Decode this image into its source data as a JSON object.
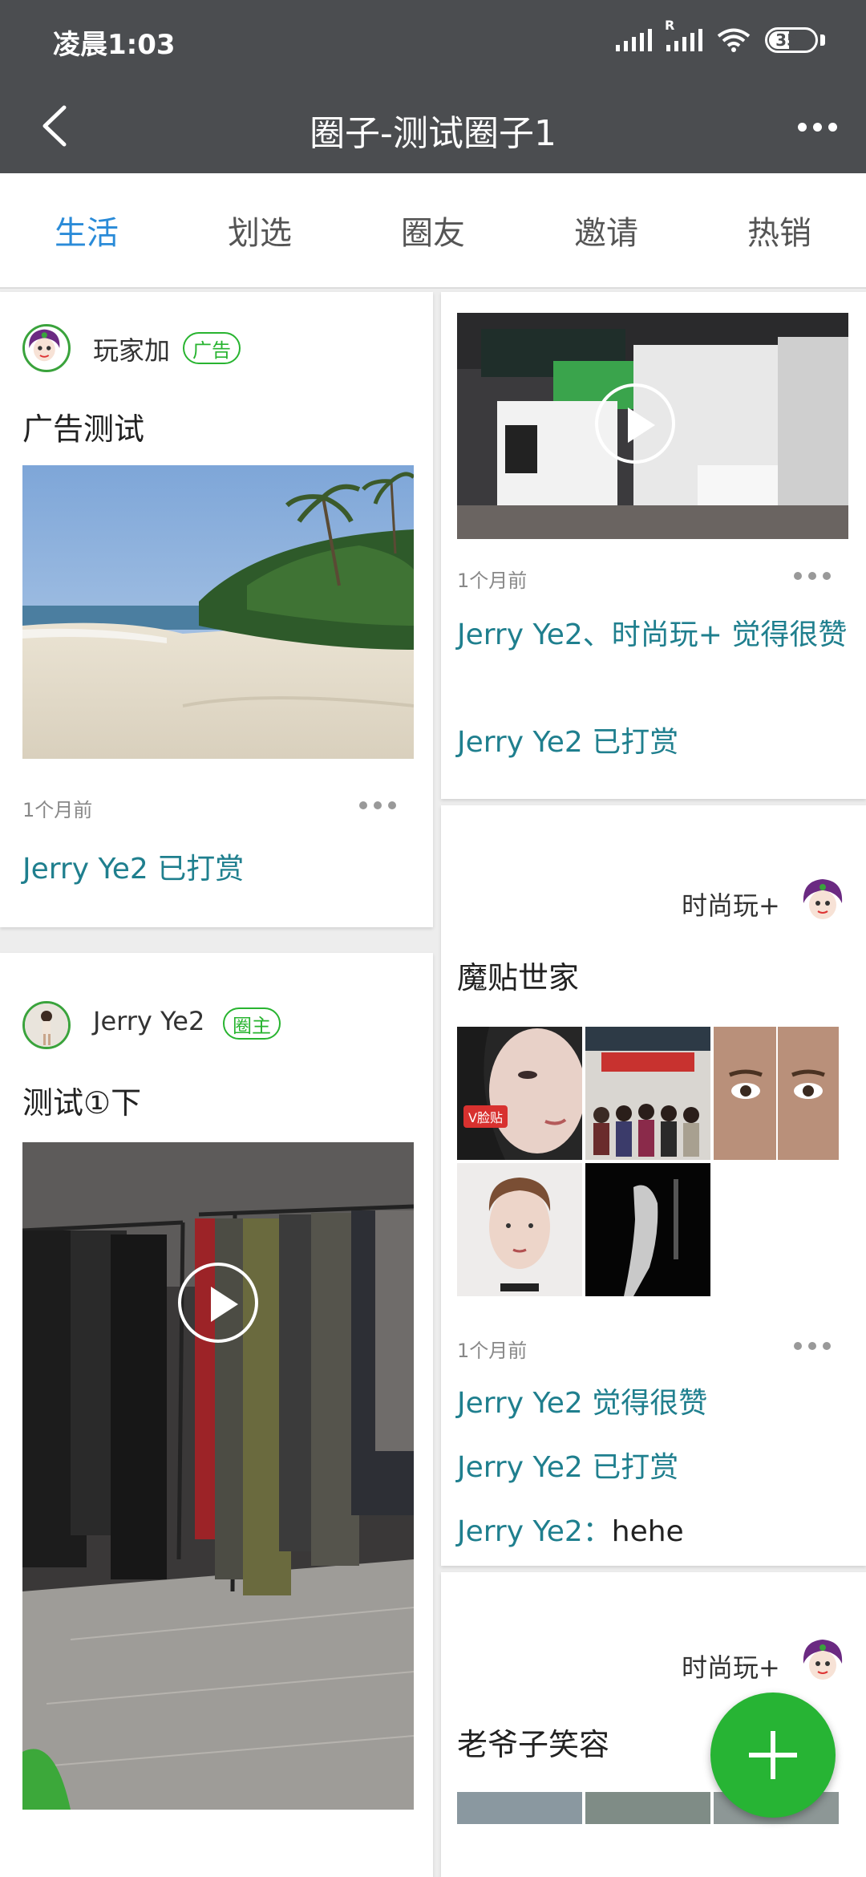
{
  "status_bar": {
    "time": "凌晨1:03",
    "battery": "35"
  },
  "header": {
    "title": "圈子-测试圈子1"
  },
  "tabs": [
    {
      "label": "生活",
      "active": true
    },
    {
      "label": "划选",
      "active": false
    },
    {
      "label": "圈友",
      "active": false
    },
    {
      "label": "邀请",
      "active": false
    },
    {
      "label": "热销",
      "active": false
    }
  ],
  "posts": {
    "ad_post": {
      "author": "玩家加",
      "badge": "广告",
      "title": "广告测试",
      "time": "1个月前",
      "interactions": [
        "Jerry Ye2 已打赏"
      ]
    },
    "video_post_right": {
      "time": "1个月前",
      "interactions": [
        "Jerry Ye2、时尚玩+ 觉得很赞",
        "Jerry Ye2 已打赏"
      ]
    },
    "mote_post": {
      "author": "时尚玩+",
      "title": "魔贴世家",
      "image_label": "V脸贴",
      "time": "1个月前",
      "interactions": [
        "Jerry Ye2 觉得很赞",
        "Jerry Ye2 已打赏"
      ],
      "comment": {
        "user": "Jerry Ye2：",
        "text": "hehe"
      }
    },
    "owner_post": {
      "author": "Jerry Ye2",
      "badge": "圈主",
      "title": "测试①下"
    },
    "laoyezi_post": {
      "author": "时尚玩+",
      "title": "老爷子笑容"
    }
  },
  "colors": {
    "accent_tab": "#2a8bd8",
    "fab": "#27b434",
    "link": "#1f7f8e",
    "badge": "#28b430",
    "header_bg": "#4b4d50"
  }
}
